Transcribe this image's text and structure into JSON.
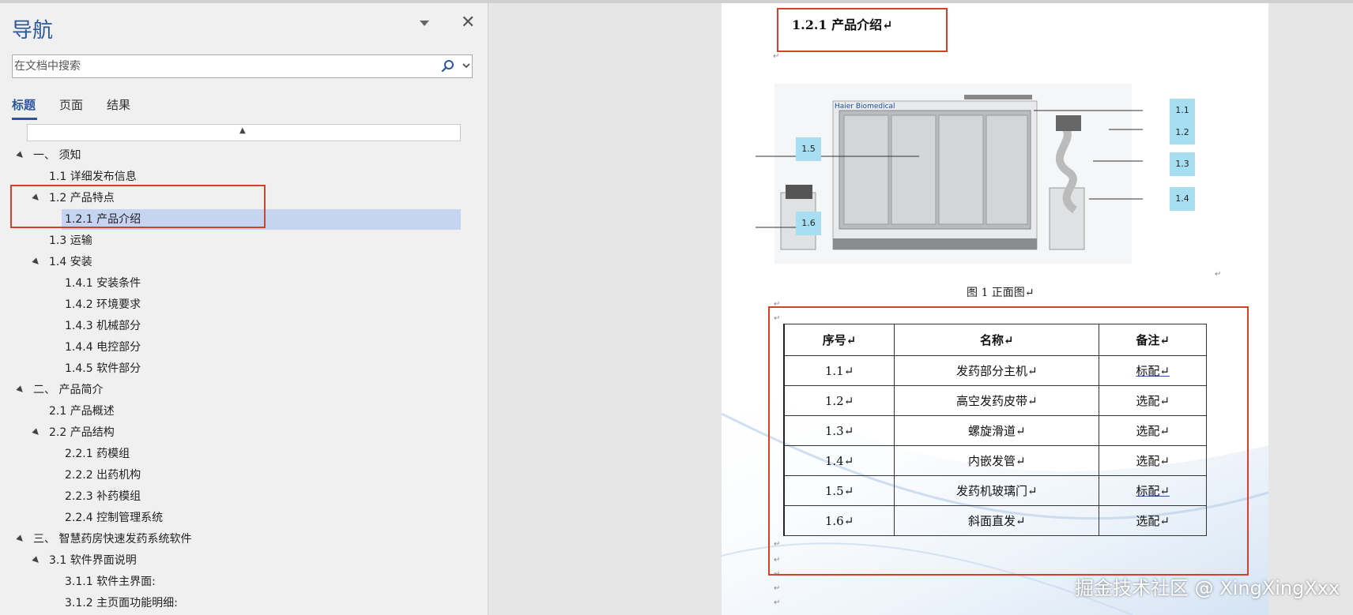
{
  "nav": {
    "title": "导航",
    "search_placeholder": "在文档中搜索",
    "tabs": [
      {
        "label": "标题"
      },
      {
        "label": "页面"
      },
      {
        "label": "结果"
      }
    ],
    "tree": [
      {
        "label": "一、 须知",
        "level": 0,
        "expanded": true
      },
      {
        "label": "1.1    详细发布信息",
        "level": 1
      },
      {
        "label": "1.2 产品特点",
        "level": 1,
        "expanded": true
      },
      {
        "label": "1.2.1 产品介绍",
        "level": 2,
        "selected": true
      },
      {
        "label": "1.3  运输",
        "level": 1
      },
      {
        "label": "1.4  安装",
        "level": 1,
        "expanded": true
      },
      {
        "label": "1.4.1 安装条件",
        "level": 2
      },
      {
        "label": "1.4.2 环境要求",
        "level": 2
      },
      {
        "label": "1.4.3 机械部分",
        "level": 2
      },
      {
        "label": "1.4.4 电控部分",
        "level": 2
      },
      {
        "label": "1.4.5 软件部分",
        "level": 2
      },
      {
        "label": "二、 产品简介",
        "level": 0,
        "expanded": true
      },
      {
        "label": "2.1 产品概述",
        "level": 1
      },
      {
        "label": "2.2 产品结构",
        "level": 1,
        "expanded": true
      },
      {
        "label": "2.2.1 药模组",
        "level": 2
      },
      {
        "label": "2.2.2 出药机构",
        "level": 2
      },
      {
        "label": "2.2.3 补药模组",
        "level": 2
      },
      {
        "label": "2.2.4 控制管理系统",
        "level": 2
      },
      {
        "label": "三、 智慧药房快速发药系统软件",
        "level": 0,
        "expanded": true
      },
      {
        "label": "3.1 软件界面说明",
        "level": 1,
        "expanded": true
      },
      {
        "label": "3.1.1 软件主界面:",
        "level": 2
      },
      {
        "label": "3.1.2 主页面功能明细:",
        "level": 2
      }
    ]
  },
  "document": {
    "heading": "1.2.1 产品介绍↵",
    "figure": {
      "brand": "Haier Biomedical",
      "callouts": [
        "1.1",
        "1.2",
        "1.3",
        "1.4",
        "1.5",
        "1.6"
      ]
    },
    "caption": "图 1  正面图↵",
    "table": {
      "headers": [
        "序号↵",
        "名称↵",
        "备注↵"
      ],
      "rows": [
        [
          "1.1↵",
          "发药部分主机↵",
          "标配↵"
        ],
        [
          "1.2↵",
          "高空发药皮带↵",
          "选配↵"
        ],
        [
          "1.3↵",
          "螺旋滑道↵",
          "选配↵"
        ],
        [
          "1.4↵",
          "内嵌发管↵",
          "选配↵"
        ],
        [
          "1.5↵",
          "发药机玻璃门↵",
          "标配↵"
        ],
        [
          "1.6↵",
          "斜面直发↵",
          "选配↵"
        ]
      ]
    },
    "paragraph_mark": "↵"
  },
  "watermark": "掘金技术社区 @ XingXingXxx",
  "colors": {
    "accent": "#2b579a",
    "highlight": "#d5402b",
    "selected": "#c5d5f1",
    "callout": "#a7def2"
  }
}
